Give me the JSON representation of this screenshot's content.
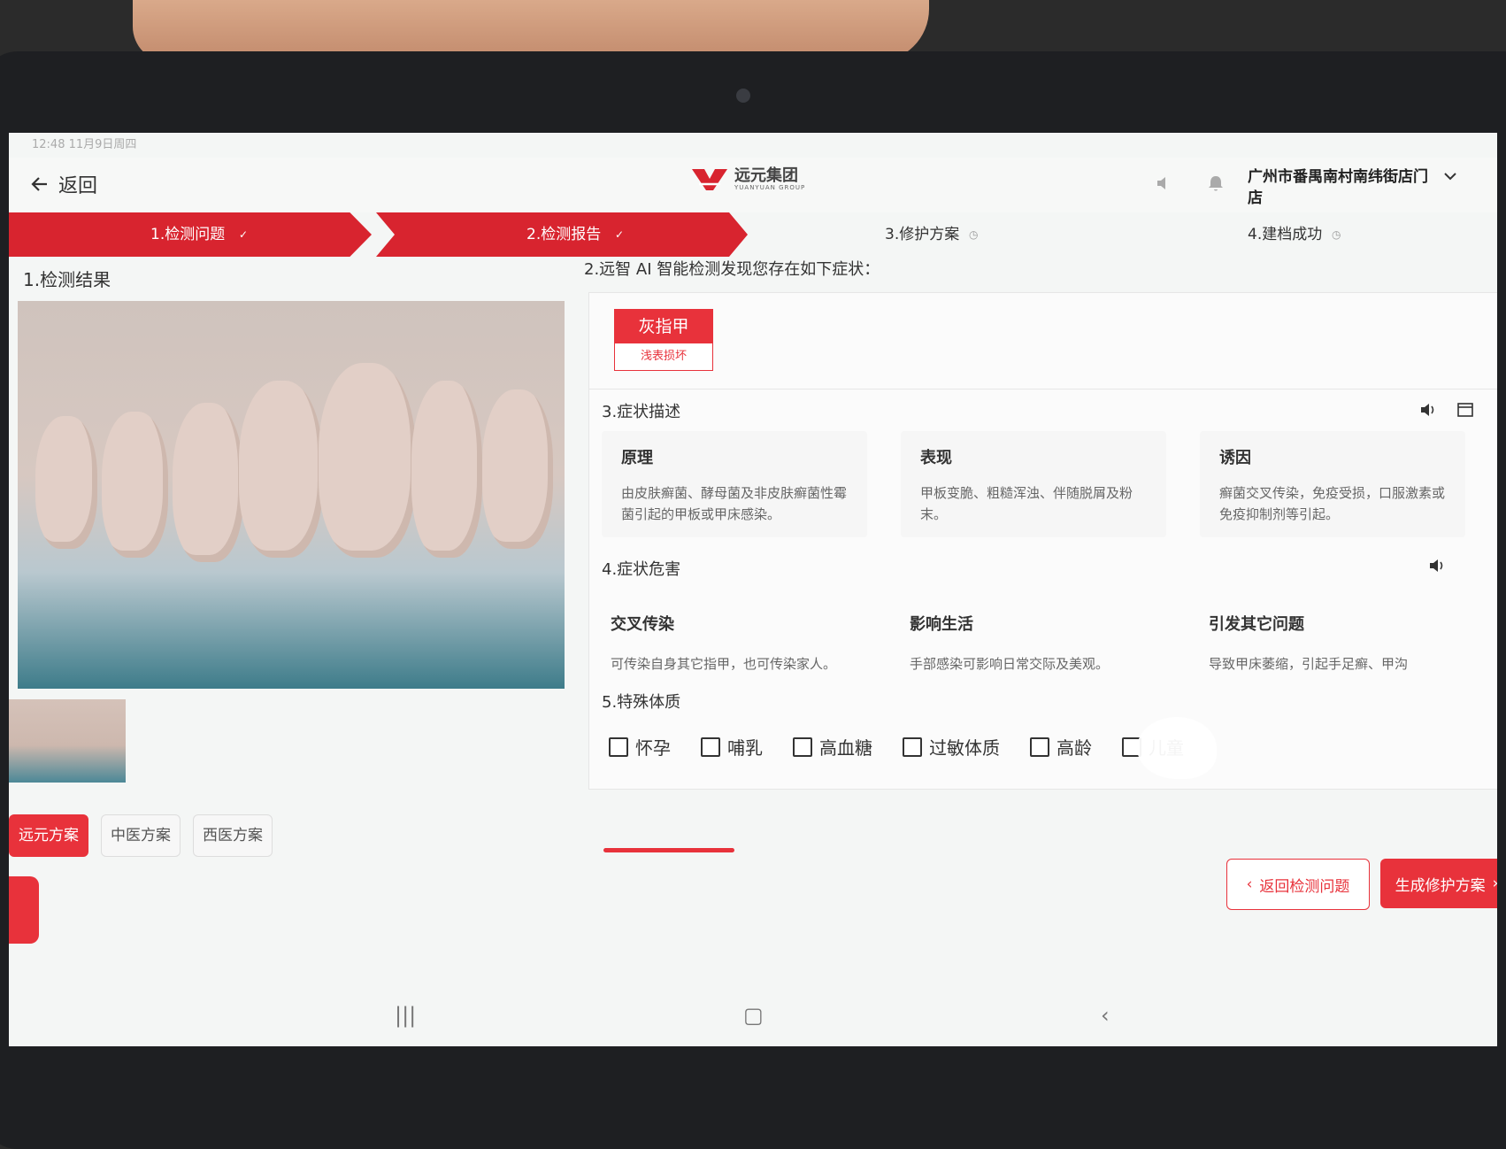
{
  "status_bar": {
    "time_text": "12:48  11月9日周四"
  },
  "header": {
    "back_label": "返回",
    "brand_name": "远元集团",
    "brand_sub": "YUANYUAN GROUP",
    "store_name": "广州市番禺南村南纬街店门店"
  },
  "steps": [
    {
      "label": "1.检测问题",
      "state": "done"
    },
    {
      "label": "2.检测报告",
      "state": "done"
    },
    {
      "label": "3.修护方案",
      "state": "pending"
    },
    {
      "label": "4.建档成功",
      "state": "pending"
    }
  ],
  "left": {
    "section_title": "1.检测结果",
    "tabs": [
      "远元方案",
      "中医方案",
      "西医方案"
    ],
    "active_tab_index": 0
  },
  "right": {
    "ai_title": "2.远智 AI 智能检测发现您存在如下症状：",
    "symptom": {
      "name": "灰指甲",
      "level": "浅表损坏"
    },
    "description": {
      "title": "3.症状描述",
      "cards": [
        {
          "title": "原理",
          "text": "由皮肤癣菌、酵母菌及非皮肤癣菌性霉菌引起的甲板或甲床感染。"
        },
        {
          "title": "表现",
          "text": "甲板变脆、粗糙浑浊、伴随脱屑及粉末。"
        },
        {
          "title": "诱因",
          "text": "癣菌交叉传染，免疫受损，口服激素或免疫抑制剂等引起。"
        }
      ]
    },
    "harm": {
      "title": "4.症状危害",
      "items": [
        {
          "title": "交叉传染",
          "text": "可传染自身其它指甲，也可传染家人。"
        },
        {
          "title": "影响生活",
          "text": "手部感染可影响日常交际及美观。"
        },
        {
          "title": "引发其它问题",
          "text": "导致甲床萎缩，引起手足癣、甲沟"
        }
      ]
    },
    "constitution": {
      "title": "5.特殊体质",
      "options": [
        "怀孕",
        "哺乳",
        "高血糖",
        "过敏体质",
        "高龄",
        "儿童"
      ]
    }
  },
  "footer": {
    "back_button": "返回检测问题",
    "next_button": "生成修护方案"
  },
  "colors": {
    "accent": "#e8323b",
    "step_active": "#d8242f"
  }
}
